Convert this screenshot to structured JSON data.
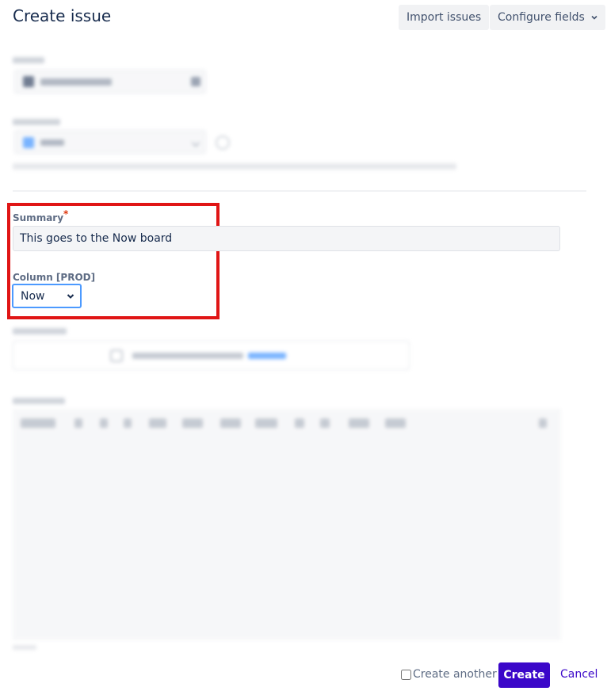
{
  "header": {
    "title": "Create issue",
    "import_label": "Import issues",
    "configure_label": "Configure fields"
  },
  "form": {
    "summary_label": "Summary",
    "required_mark": "*",
    "summary_value": "This goes to the Now board",
    "column_label": "Column [PROD]",
    "column_selected": "Now"
  },
  "footer": {
    "create_another_label": "Create another",
    "create_label": "Create",
    "cancel_label": "Cancel"
  },
  "colors": {
    "primary": "#3b07c9",
    "highlight": "#e01515",
    "focus": "#4c9aff"
  },
  "icons": {
    "configure_caret": "chevron-down-icon",
    "select_caret": "chevron-down-icon"
  }
}
